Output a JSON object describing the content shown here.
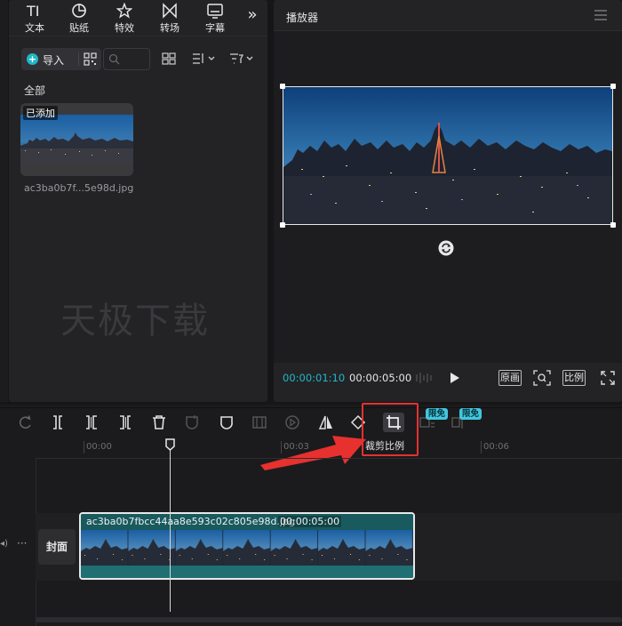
{
  "tabs": [
    {
      "label": "文本",
      "icon": "text-tool-icon"
    },
    {
      "label": "贴纸",
      "icon": "sticker-icon"
    },
    {
      "label": "特效",
      "icon": "effects-star-icon"
    },
    {
      "label": "转场",
      "icon": "transition-icon"
    },
    {
      "label": "字幕",
      "icon": "subtitle-icon"
    }
  ],
  "tabs_more": "»",
  "media": {
    "import_label": "导入",
    "section_label": "全部",
    "card_badge": "已添加",
    "file_name": "ac3ba0b7f...5e98d.jpg"
  },
  "watermark": "天极下载",
  "player": {
    "title": "播放器",
    "time_current": "00:00:01:10",
    "time_total": "00:00:05:00",
    "btn_original": "原画",
    "btn_ratio": "比例"
  },
  "toolbar": {
    "crop_tooltip": "裁剪比例",
    "free_badge": "限免"
  },
  "ruler": {
    "ticks": [
      "00:00",
      "00:03",
      "00:06"
    ]
  },
  "track": {
    "cover_label": "封面",
    "more": "···"
  },
  "clip": {
    "name": "ac3ba0b7fbcc44aa8e593c02c805e98d.jpg",
    "duration": "00:00:05:00"
  },
  "colors": {
    "accent": "#1fb8c8",
    "highlight_red": "#e6312f",
    "clip_teal": "#1f6f73",
    "badge": "#43c6de"
  }
}
